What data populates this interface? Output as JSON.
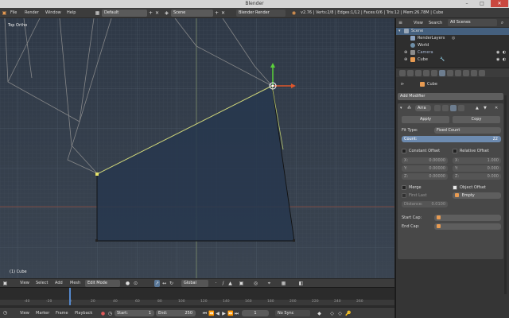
{
  "window": {
    "title": "Blender",
    "minimize": "–",
    "maximize": "□",
    "close": "✕"
  },
  "topbar": {
    "menus": [
      "File",
      "Render",
      "Window",
      "Help"
    ],
    "screen_layout": "Default",
    "scene": "Scene",
    "engine": "Blender Render",
    "stats": "v2.76 | Verts:2/8 | Edges:1/12 | Faces:0/6 | Tris:12 | Mem:26.78M | Cube"
  },
  "viewport": {
    "view_label": "Top Ortho",
    "object_label": "(1) Cube"
  },
  "viewport_header": {
    "menus": [
      "View",
      "Select",
      "Add",
      "Mesh"
    ],
    "mode": "Edit Mode",
    "orientation": "Global"
  },
  "timeline": {
    "ticks": [
      "-40",
      "-20",
      "0",
      "20",
      "40",
      "60",
      "80",
      "100",
      "120",
      "140",
      "160",
      "180",
      "200",
      "220",
      "240",
      "260"
    ],
    "menus": [
      "View",
      "Marker",
      "Frame",
      "Playback"
    ],
    "start_label": "Start:",
    "start_value": "1",
    "end_label": "End:",
    "end_value": "250",
    "current_frame": "1",
    "sync": "No Sync"
  },
  "outliner": {
    "view_menu": "View",
    "search_menu": "Search",
    "scope": "All Scenes",
    "items": [
      "Scene",
      "RenderLayers",
      "World",
      "Camera",
      "Cube"
    ]
  },
  "properties": {
    "object_name": "Cube",
    "add_modifier": "Add Modifier",
    "modifier_name": "Arra",
    "apply": "Apply",
    "copy": "Copy",
    "fit_type_label": "Fit Type:",
    "fit_type_value": "Fixed Count",
    "count_label": "Count:",
    "count_value": "22",
    "constant_offset": "Constant Offset",
    "relative_offset": "Relative Offset",
    "x_label": "X:",
    "y_label": "Y:",
    "z_label": "Z:",
    "const_x": "0.00000",
    "const_y": "0.00000",
    "const_z": "0.00000",
    "rel_x": "1.000",
    "rel_y": "0.000",
    "rel_z": "0.000",
    "merge": "Merge",
    "object_offset": "Object Offset",
    "first_last": "First Last",
    "offset_object": "Empty",
    "distance_label": "Distance:",
    "distance_value": "0.0100",
    "start_cap": "Start Cap:",
    "end_cap": "End Cap:"
  },
  "colors": {
    "accent_blue": "#5588cc",
    "gizmo_x": "#e0562b",
    "gizmo_y": "#5bd13b",
    "edge_selected": "#cfd67a"
  }
}
